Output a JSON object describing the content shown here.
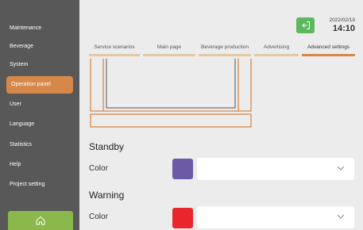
{
  "sidebar": {
    "items": [
      {
        "label": "Maintenance"
      },
      {
        "label": "Beverage"
      },
      {
        "label": "System"
      },
      {
        "label": "Operation panel",
        "active": true
      },
      {
        "label": "User"
      },
      {
        "label": "Language"
      },
      {
        "label": "Statistics"
      },
      {
        "label": "Help"
      },
      {
        "label": "Project setting"
      }
    ],
    "home_icon": "home-icon"
  },
  "header": {
    "date": "2022/02/19",
    "time": "14:10",
    "exit_icon": "exit-icon"
  },
  "tabs": [
    {
      "label": "Service scenarios"
    },
    {
      "label": "Main page"
    },
    {
      "label": "Beverage production"
    },
    {
      "label": "Advertising"
    },
    {
      "label": "Advanced settings",
      "active": true
    }
  ],
  "sections": [
    {
      "title": "Standby",
      "color_label": "Color",
      "color_value": "#6b5aa6",
      "select_value": "",
      "select_icon": "chevron-down-icon"
    },
    {
      "title": "Warning",
      "color_label": "Color",
      "color_value": "#e8262b",
      "select_value": "",
      "select_icon": "chevron-down-icon"
    }
  ],
  "colors": {
    "sidebar_bg": "#585858",
    "accent": "#d6884a",
    "home_button": "#8ab84a",
    "exit_button": "#5cb85c"
  }
}
